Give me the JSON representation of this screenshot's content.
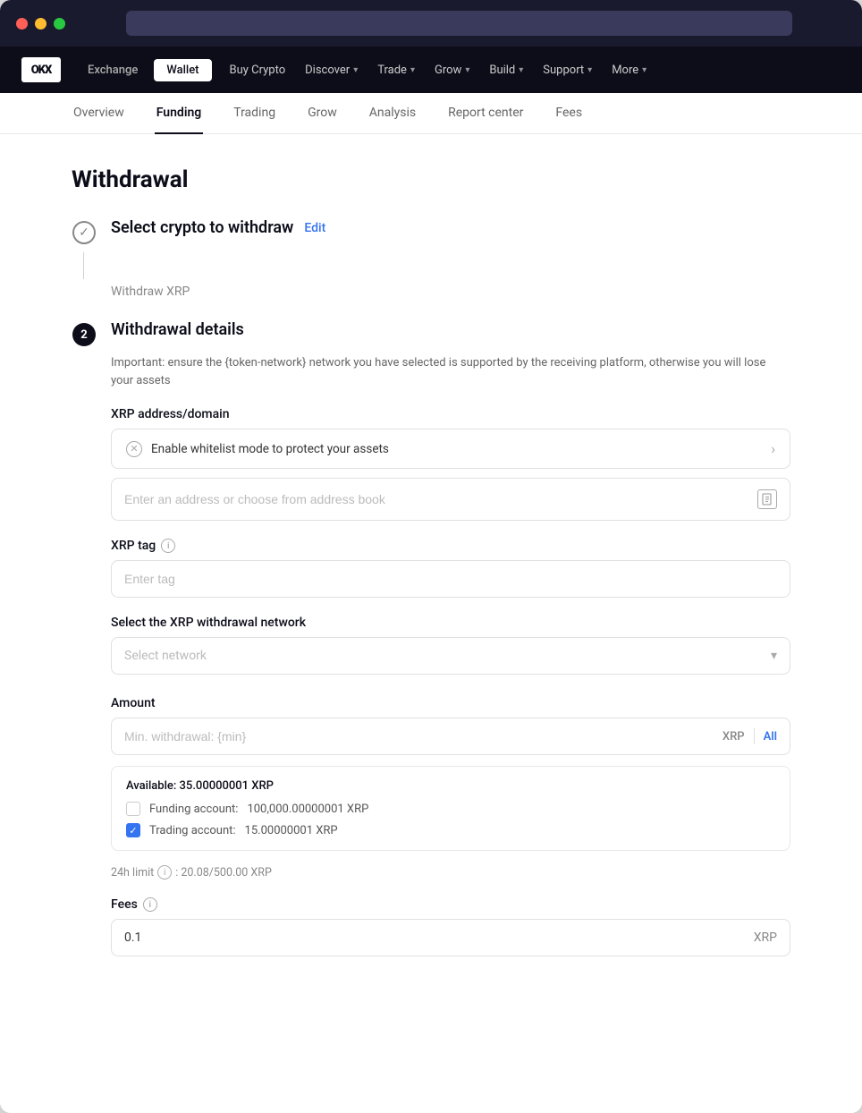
{
  "window": {
    "dots": [
      "red",
      "yellow",
      "green"
    ]
  },
  "navbar": {
    "logo": "OKX",
    "tabs": [
      {
        "label": "Exchange",
        "active": false
      },
      {
        "label": "Wallet",
        "active": true
      }
    ],
    "menu_items": [
      {
        "label": "Buy Crypto",
        "has_chevron": false
      },
      {
        "label": "Discover",
        "has_chevron": true
      },
      {
        "label": "Trade",
        "has_chevron": true
      },
      {
        "label": "Grow",
        "has_chevron": true
      },
      {
        "label": "Build",
        "has_chevron": true
      },
      {
        "label": "Support",
        "has_chevron": true
      },
      {
        "label": "More",
        "has_chevron": true
      }
    ]
  },
  "subnav": {
    "items": [
      {
        "label": "Overview",
        "active": false
      },
      {
        "label": "Funding",
        "active": true
      },
      {
        "label": "Trading",
        "active": false
      },
      {
        "label": "Grow",
        "active": false
      },
      {
        "label": "Analysis",
        "active": false
      },
      {
        "label": "Report center",
        "active": false
      },
      {
        "label": "Fees",
        "active": false
      }
    ]
  },
  "page": {
    "title": "Withdrawal",
    "step1": {
      "label": "Select crypto to withdraw",
      "edit_label": "Edit",
      "subtitle": "Withdraw XRP"
    },
    "step2": {
      "number": "2",
      "label": "Withdrawal details",
      "warning": "Important: ensure the {token-network} network you have selected is supported by the receiving platform, otherwise you will lose your assets",
      "address_label": "XRP address/domain",
      "whitelist_text": "Enable whitelist mode to protect your assets",
      "address_placeholder": "Enter an address or choose from address book",
      "tag_label": "XRP tag",
      "tag_info": "i",
      "tag_placeholder": "Enter tag",
      "network_label": "Select the XRP withdrawal network",
      "network_placeholder": "Select network",
      "amount_label": "Amount",
      "amount_placeholder": "Min. withdrawal: {min}",
      "amount_currency": "XRP",
      "amount_all": "All",
      "available_label": "Available: ",
      "available_amount": "35.00000001 XRP",
      "funding_account_label": "Funding account:",
      "funding_account_amount": "100,000.00000001 XRP",
      "trading_account_label": "Trading account:",
      "trading_account_amount": "15.00000001 XRP",
      "limit_label": "24h limit",
      "limit_value": ": 20.08/500.00 XRP",
      "fees_label": "Fees",
      "fees_info": "i",
      "fees_value": "0.1",
      "fees_currency": "XRP"
    }
  }
}
